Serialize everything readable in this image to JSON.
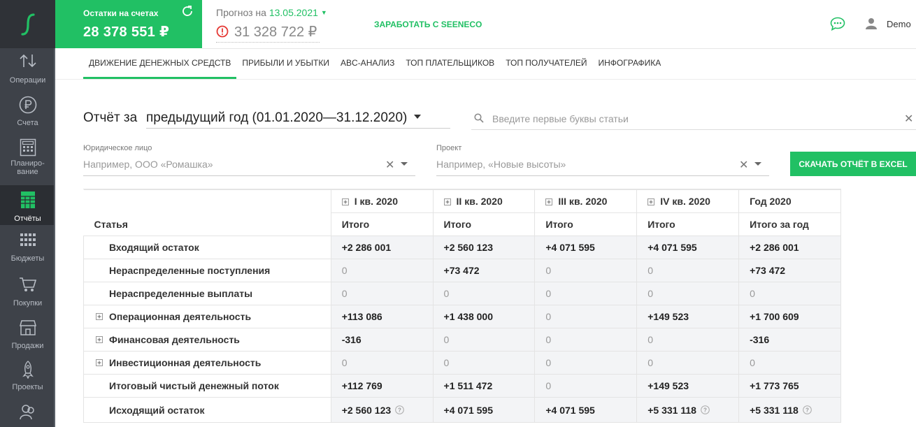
{
  "sidebar": {
    "items": [
      {
        "label": "Операции",
        "icon": "arrows-icon"
      },
      {
        "label": "Счета",
        "icon": "ruble-coin-icon"
      },
      {
        "label": "Планиро-\nвание",
        "icon": "calculator-icon"
      },
      {
        "label": "Отчёты",
        "icon": "report-icon",
        "active": true
      },
      {
        "label": "Бюджеты",
        "icon": "grid-icon"
      },
      {
        "label": "Покупки",
        "icon": "cart-icon"
      },
      {
        "label": "Продажи",
        "icon": "shop-icon"
      },
      {
        "label": "Проекты",
        "icon": "rocket-icon"
      },
      {
        "label": "",
        "icon": "people-icon"
      }
    ]
  },
  "header": {
    "balance_title": "Остатки на счетах",
    "balance_value": "28 378 551 ₽",
    "forecast_label": "Прогноз на",
    "forecast_date": "13.05.2021",
    "forecast_value": "31 328 722 ₽",
    "earn_link": "ЗАРАБОТАТЬ С SEENECO",
    "user_name": "Demo"
  },
  "tabs": [
    {
      "label": "ДВИЖЕНИЕ ДЕНЕЖНЫХ СРЕДСТВ",
      "active": true
    },
    {
      "label": "ПРИБЫЛИ И УБЫТКИ"
    },
    {
      "label": "ABC-АНАЛИЗ"
    },
    {
      "label": "ТОП ПЛАТЕЛЬЩИКОВ"
    },
    {
      "label": "ТОП ПОЛУЧАТЕЛЕЙ"
    },
    {
      "label": "ИНФОГРАФИКА"
    }
  ],
  "report": {
    "title": "Отчёт за",
    "period_strong": "предыдущий год",
    "period_range": "(01.01.2020—31.12.2020)",
    "search_placeholder": "Введите первые буквы статьи"
  },
  "filters": {
    "entity_label": "Юридическое лицо",
    "entity_placeholder": "Например, ООО «Ромашка»",
    "project_label": "Проект",
    "project_placeholder": "Например, «Новые высоты»",
    "excel_button": "СКАЧАТЬ ОТЧЁТ В EXCEL"
  },
  "table": {
    "article_header": "Статья",
    "quarters": [
      "I кв. 2020",
      "II кв. 2020",
      "III кв. 2020",
      "IV кв. 2020",
      "Год 2020"
    ],
    "subheaders": [
      "Итого",
      "Итого",
      "Итого",
      "Итого",
      "Итого за год"
    ],
    "rows": [
      {
        "name": "Входящий остаток",
        "expandable": false,
        "values": [
          "+2 286 001",
          "+2 560 123",
          "+4 071 595",
          "+4 071 595",
          "+2 286 001"
        ]
      },
      {
        "name": "Нераспределенные поступления",
        "expandable": false,
        "values": [
          "0",
          "+73 472",
          "0",
          "0",
          "+73 472"
        ]
      },
      {
        "name": "Нераспределенные выплаты",
        "expandable": false,
        "values": [
          "0",
          "0",
          "0",
          "0",
          "0"
        ]
      },
      {
        "name": "Операционная деятельность",
        "expandable": true,
        "values": [
          "+113 086",
          "+1 438 000",
          "0",
          "+149 523",
          "+1 700 609"
        ]
      },
      {
        "name": "Финансовая деятельность",
        "expandable": true,
        "values": [
          "-316",
          "0",
          "0",
          "0",
          "-316"
        ]
      },
      {
        "name": "Инвестиционная деятельность",
        "expandable": true,
        "values": [
          "0",
          "0",
          "0",
          "0",
          "0"
        ]
      },
      {
        "name": "Итоговый чистый денежный поток",
        "expandable": false,
        "values": [
          "+112 769",
          "+1 511 472",
          "0",
          "+149 523",
          "+1 773 765"
        ]
      },
      {
        "name": "Исходящий остаток",
        "expandable": false,
        "values": [
          "+2 560 123",
          "+4 071 595",
          "+4 071 595",
          "+5 331 118",
          "+5 331 118"
        ],
        "help": [
          true,
          false,
          false,
          true,
          true
        ]
      }
    ]
  },
  "colors": {
    "accent": "#21c064",
    "sidebar": "#3e4249"
  }
}
